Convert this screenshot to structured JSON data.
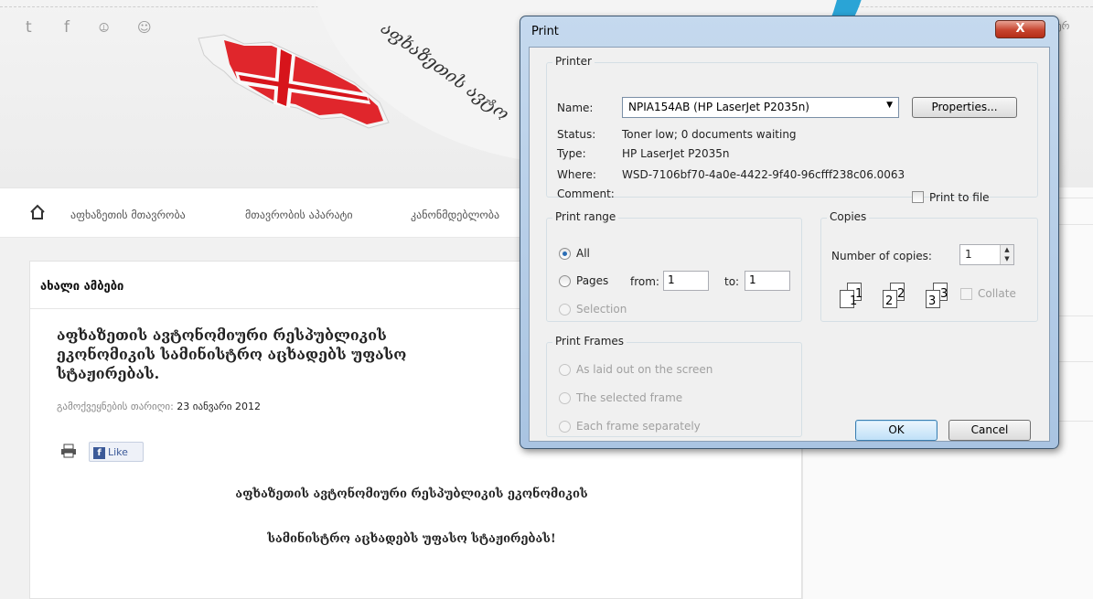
{
  "site": {
    "social_icons": [
      "twitter-icon",
      "facebook-icon",
      "rss-icon",
      "mail-icon"
    ],
    "social_glyphs": [
      "t",
      "f",
      "⦹",
      "☺"
    ],
    "banner_arc_text": "აფხაზეთის ავტო",
    "right_tab_label": "ერ",
    "nav": {
      "home_icon": "home-icon",
      "items": [
        "აფხაზეთის მთავრობა",
        "მთავრობის აპარატი",
        "კანონმდებლობა"
      ]
    },
    "section_title": "ახალი ამბები",
    "article": {
      "headline": "აფხაზეთის ავტონომიური რესპუბლიკის ეკონომიკის სამინისტრო აცხადებს უფასო სტაჟირებას.",
      "date_label": "გამოქვეყნების თარიღი:",
      "date_value": "23 იანვარი 2012",
      "like_label": "Like",
      "fb_glyph": "f",
      "body_line1": "აფხაზეთის ავტონომიური რესპუბლიკის ეკონომიკის",
      "body_line2": "სამინისტრო აცხადებს უფასო სტაჟირებას!"
    }
  },
  "dialog": {
    "title": "Print",
    "close_label": "X",
    "printer": {
      "group_label": "Printer",
      "name_label": "Name:",
      "name_value": "NPIA154AB (HP LaserJet P2035n)",
      "properties_label": "Properties...",
      "status_label": "Status:",
      "status_value": "Toner low; 0 documents waiting",
      "type_label": "Type:",
      "type_value": "HP LaserJet P2035n",
      "where_label": "Where:",
      "where_value": "WSD-7106bf70-4a0e-4422-9f40-96cfff238c06.0063",
      "comment_label": "Comment:",
      "print_to_file_label": "Print to file"
    },
    "print_range": {
      "group_label": "Print range",
      "all_label": "All",
      "pages_label": "Pages",
      "from_label": "from:",
      "from_value": "1",
      "to_label": "to:",
      "to_value": "1",
      "selection_label": "Selection"
    },
    "copies": {
      "group_label": "Copies",
      "number_label": "Number of copies:",
      "number_value": "1",
      "collate_label": "Collate",
      "page_numbers": [
        "1",
        "1",
        "2",
        "2",
        "3",
        "3"
      ]
    },
    "print_frames": {
      "group_label": "Print Frames",
      "option1": "As laid out on the screen",
      "option2": "The selected frame",
      "option3": "Each frame separately"
    },
    "ok_label": "OK",
    "cancel_label": "Cancel"
  }
}
